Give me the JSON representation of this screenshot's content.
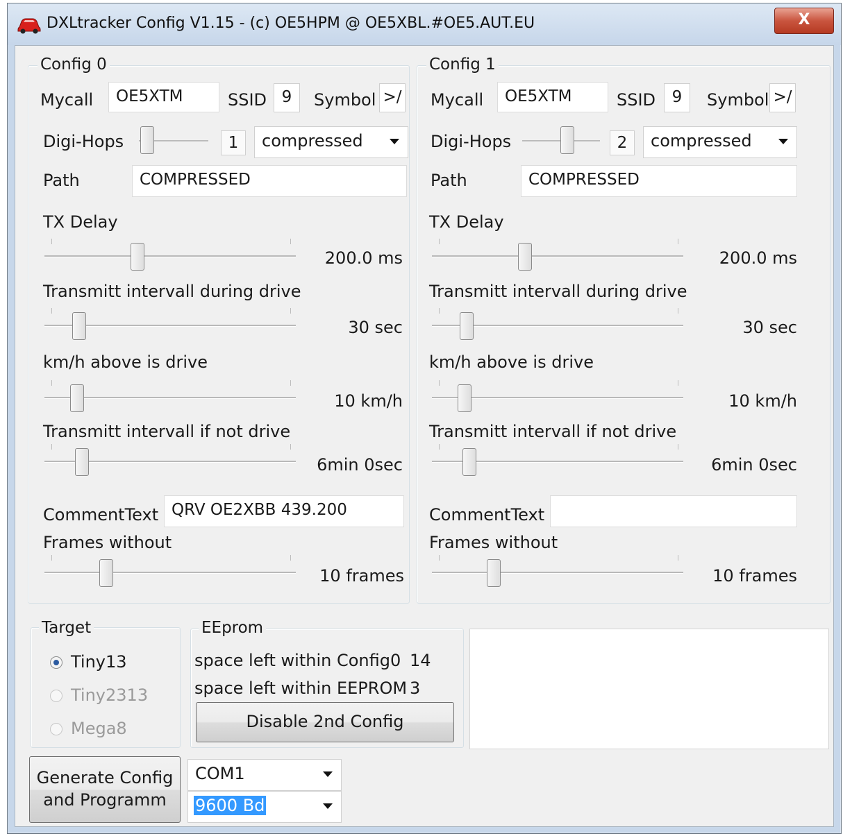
{
  "window": {
    "title": "DXLtracker Config V1.15  -  (c) OE5HPM @ OE5XBL.#OE5.AUT.EU",
    "close_label": "X"
  },
  "configs": [
    {
      "group_label": "Config 0",
      "mycall_label": "Mycall",
      "mycall": "OE5XTM",
      "ssid_label": "SSID",
      "ssid": "9",
      "symbol_label": "Symbol",
      "symbol": ">/",
      "digihops_label": "Digi-Hops",
      "digihops_value": "1",
      "digihops_level": 0,
      "path_mode": "compressed",
      "path_label": "Path",
      "path": "COMPRESSED",
      "txdelay_label": "TX Delay",
      "txdelay_value": "200.0 ms",
      "txdelay_level": 0.36,
      "interval_drive_label": "Transmitt intervall during drive",
      "interval_drive_value": "30 sec",
      "interval_drive_level": 0.12,
      "kmh_label": "km/h above is drive",
      "kmh_value": "10 km/h",
      "kmh_level": 0.11,
      "interval_nodrive_label": "Transmitt intervall if not drive",
      "interval_nodrive_value": "6min 0sec",
      "interval_nodrive_level": 0.13,
      "comment_label": "CommentText",
      "comment": "QRV OE2XBB 439.200",
      "frames_label": "Frames without",
      "frames_value": "10 frames",
      "frames_level": 0.23
    },
    {
      "group_label": "Config 1",
      "mycall_label": "Mycall",
      "mycall": "OE5XTM",
      "ssid_label": "SSID",
      "ssid": "9",
      "symbol_label": "Symbol",
      "symbol": ">/",
      "digihops_label": "Digi-Hops",
      "digihops_value": "2",
      "digihops_level": 0.5,
      "path_mode": "compressed",
      "path_label": "Path",
      "path": "COMPRESSED",
      "txdelay_label": "TX Delay",
      "txdelay_value": "200.0 ms",
      "txdelay_level": 0.36,
      "interval_drive_label": "Transmitt intervall during drive",
      "interval_drive_value": "30 sec",
      "interval_drive_level": 0.12,
      "kmh_label": "km/h above is drive",
      "kmh_value": "10 km/h",
      "kmh_level": 0.11,
      "interval_nodrive_label": "Transmitt intervall if not drive",
      "interval_nodrive_value": "6min 0sec",
      "interval_nodrive_level": 0.13,
      "comment_label": "CommentText",
      "comment": "",
      "frames_label": "Frames without",
      "frames_value": "10 frames",
      "frames_level": 0.23
    }
  ],
  "target": {
    "group_label": "Target",
    "options": [
      {
        "label": "Tiny13",
        "selected": true,
        "enabled": true
      },
      {
        "label": "Tiny2313",
        "selected": false,
        "enabled": false
      },
      {
        "label": "Mega8",
        "selected": false,
        "enabled": false
      }
    ]
  },
  "eeprom": {
    "group_label": "EEprom",
    "config0_label": "space left within Config0",
    "config0_value": "14",
    "eeprom_label": "space left within EEPROM",
    "eeprom_value": "3",
    "disable_button": "Disable 2nd Config"
  },
  "bottom": {
    "generate_line1": "Generate Config",
    "generate_line2": "and Programm",
    "port": "COM1",
    "baud": "9600 Bd"
  },
  "colors": {
    "titlebar": "#c6d6ea",
    "close": "#c9553f",
    "selection": "#3399ff"
  }
}
